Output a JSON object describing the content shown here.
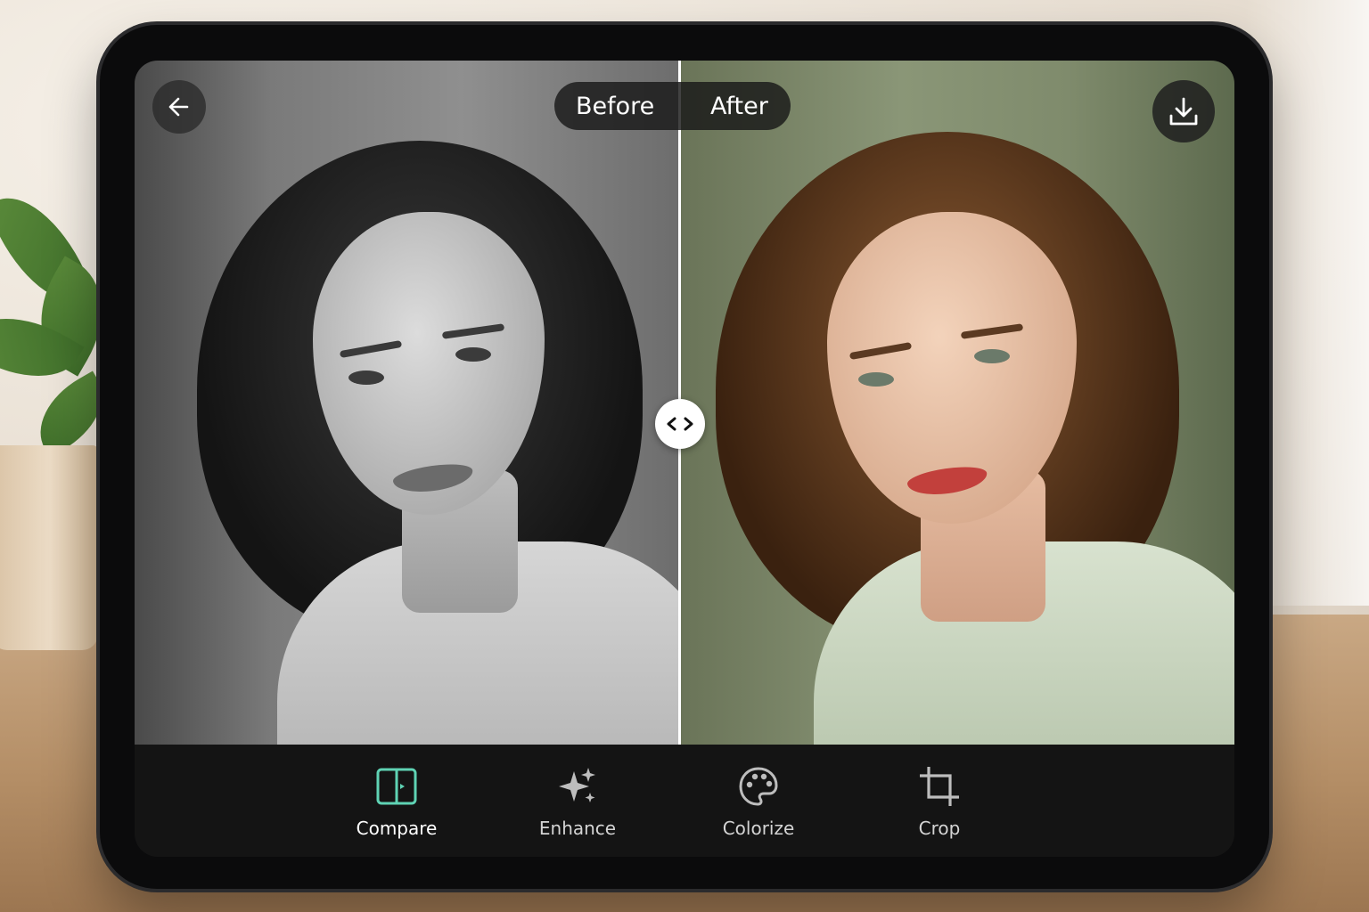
{
  "header": {
    "back_icon": "arrow-left-icon",
    "download_icon": "download-icon"
  },
  "compare_toggle": {
    "before_label": "Before",
    "after_label": "After"
  },
  "slider": {
    "icon": "chevrons-left-right-icon"
  },
  "toolbar": {
    "items": [
      {
        "label": "Compare",
        "icon": "split-compare-icon",
        "active": true
      },
      {
        "label": "Enhance",
        "icon": "sparkle-icon",
        "active": false
      },
      {
        "label": "Colorize",
        "icon": "palette-icon",
        "active": false
      },
      {
        "label": "Crop",
        "icon": "crop-icon",
        "active": false
      }
    ]
  },
  "colors": {
    "accent": "#5fd3b4",
    "toolbar_bg": "#141414",
    "divider": "#ffffff"
  }
}
